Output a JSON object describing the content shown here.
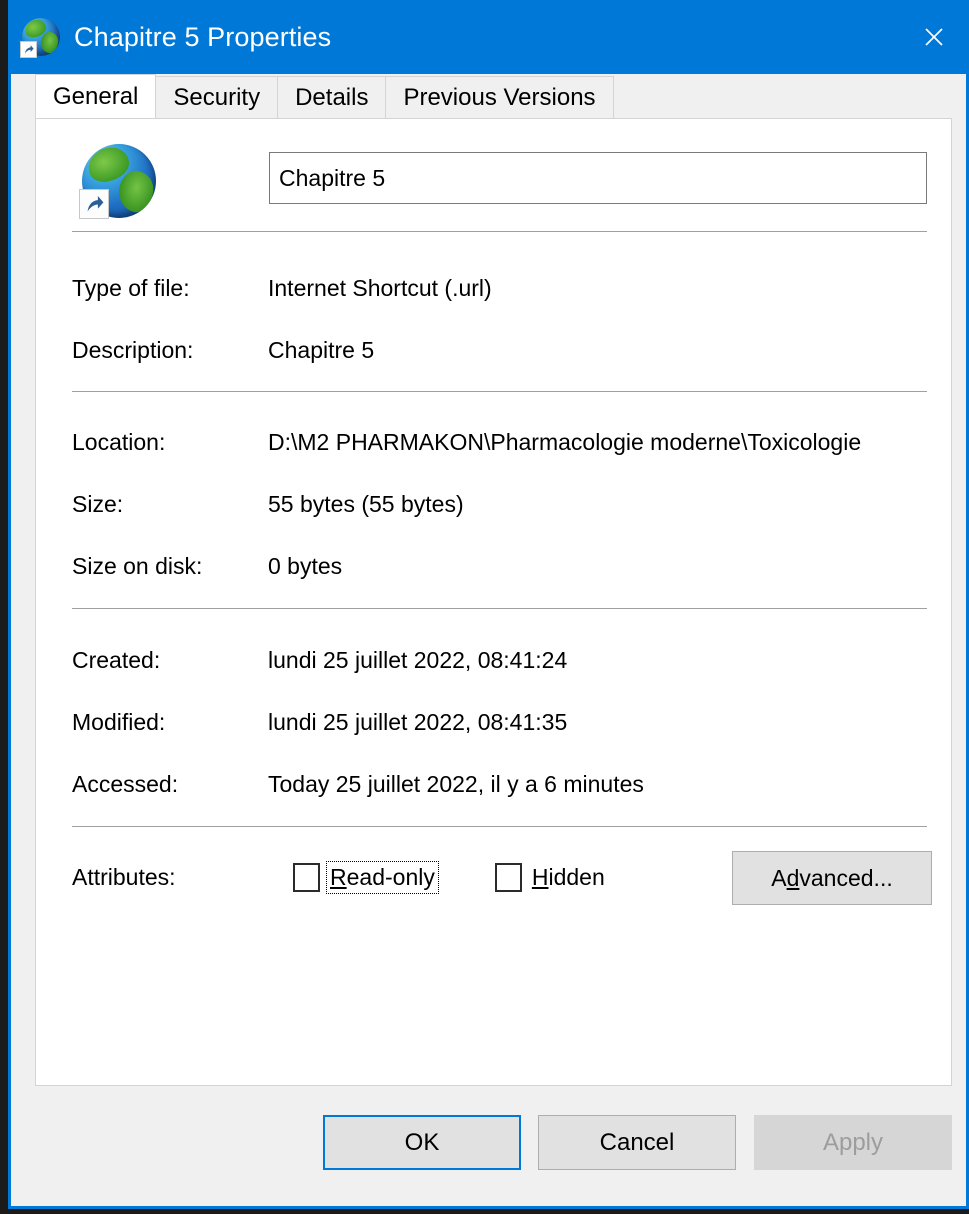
{
  "window": {
    "title": "Chapitre 5 Properties",
    "icon": "internet-shortcut-globe-icon",
    "close_label": "✕",
    "accent_color": "#0078d7",
    "titlebar_text_color": "#ffffff"
  },
  "tabs": [
    {
      "label": "General",
      "active": true
    },
    {
      "label": "Security",
      "active": false
    },
    {
      "label": "Details",
      "active": false
    },
    {
      "label": "Previous Versions",
      "active": false
    }
  ],
  "general": {
    "filename_value": "Chapitre 5",
    "filename_placeholder": "",
    "rows": [
      {
        "label": "Type of file:",
        "value": "Internet Shortcut (.url)"
      },
      {
        "label": "Description:",
        "value": "Chapitre 5"
      },
      {
        "label": "Location:",
        "value": "D:\\M2 PHARMAKON\\Pharmacologie moderne\\Toxicologie"
      },
      {
        "label": "Size:",
        "value": "55 bytes (55 bytes)"
      },
      {
        "label": "Size on disk:",
        "value": "0 bytes"
      },
      {
        "label": "Created:",
        "value": "lundi 25 juillet 2022, 08:41:24"
      },
      {
        "label": "Modified:",
        "value": "lundi 25 juillet 2022, 08:41:35"
      },
      {
        "label": "Accessed:",
        "value": "Today 25 juillet 2022, il y a 6 minutes"
      }
    ],
    "attributes": {
      "label": "Attributes:",
      "readonly": {
        "accel": "R",
        "rest": "ead-only",
        "checked": false,
        "focused": true
      },
      "hidden": {
        "accel": "H",
        "rest": "idden",
        "checked": false,
        "focused": false
      },
      "advanced": {
        "pre": "A",
        "accel": "d",
        "rest": "vanced..."
      }
    }
  },
  "footer": {
    "ok_label": "OK",
    "cancel_label": "Cancel",
    "apply_label": "Apply",
    "apply_disabled": true,
    "ok_default": true
  }
}
